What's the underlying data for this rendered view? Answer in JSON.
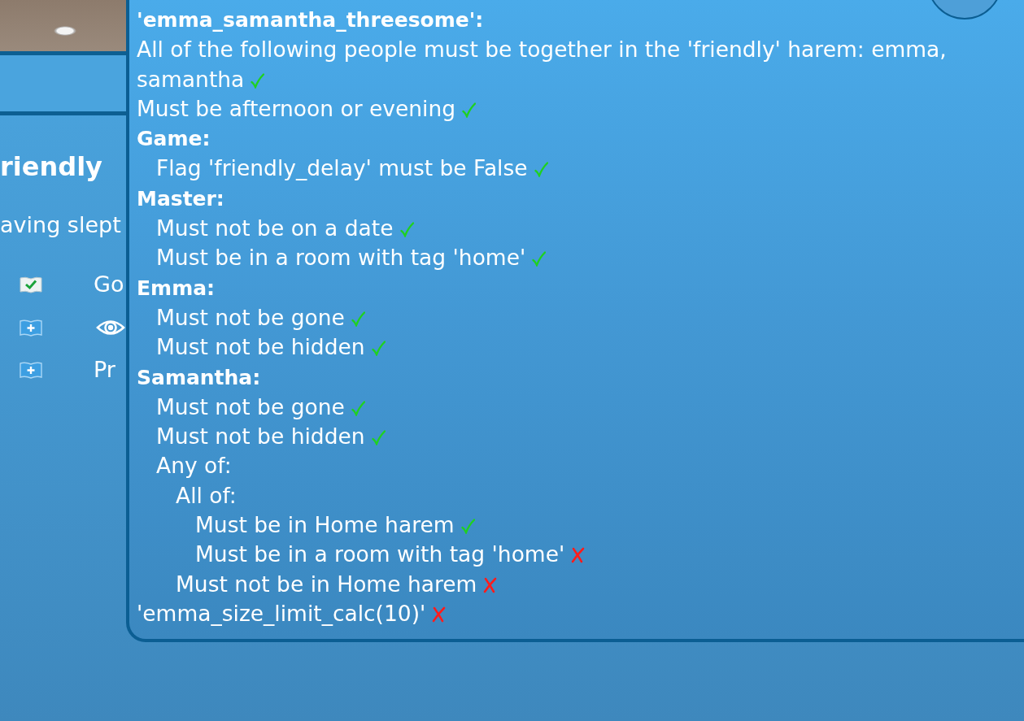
{
  "background": {
    "title": "riendly",
    "subtitle": "aving slept",
    "entries": [
      {
        "kind": "label",
        "completed": true,
        "label": "Go"
      },
      {
        "kind": "eye",
        "completed": false
      },
      {
        "kind": "label",
        "completed": false,
        "label": "Pr"
      }
    ]
  },
  "tooltip": {
    "title": "'emma_samantha_threesome':",
    "lines": [
      {
        "kind": "condition",
        "text": "All of the following people must be together in the 'friendly' harem: emma, samantha",
        "passed": true
      },
      {
        "kind": "condition",
        "text": "Must be afternoon or evening",
        "passed": true
      },
      {
        "kind": "heading",
        "text": "Game:",
        "children": [
          {
            "kind": "condition",
            "text": "Flag 'friendly_delay' must be False",
            "passed": true
          }
        ]
      },
      {
        "kind": "heading",
        "text": "Master:",
        "children": [
          {
            "kind": "condition",
            "text": "Must not be on a date",
            "passed": true
          },
          {
            "kind": "condition",
            "text": "Must be in a room with tag 'home'",
            "passed": true
          }
        ]
      },
      {
        "kind": "heading",
        "text": "Emma:",
        "children": [
          {
            "kind": "condition",
            "text": "Must not be gone",
            "passed": true
          },
          {
            "kind": "condition",
            "text": "Must not be hidden",
            "passed": true
          }
        ]
      },
      {
        "kind": "heading",
        "text": "Samantha:",
        "children": [
          {
            "kind": "condition",
            "text": "Must not be gone",
            "passed": true
          },
          {
            "kind": "condition",
            "text": "Must not be hidden",
            "passed": true
          },
          {
            "kind": "group",
            "text": "Any of:",
            "children": [
              {
                "kind": "group",
                "text": "All of:",
                "children": [
                  {
                    "kind": "condition",
                    "text": "Must be in Home harem",
                    "passed": true
                  },
                  {
                    "kind": "condition",
                    "text": "Must be in a room with tag 'home'",
                    "passed": false
                  }
                ]
              },
              {
                "kind": "condition",
                "text": "Must not be in Home harem",
                "passed": false
              }
            ]
          }
        ]
      },
      {
        "kind": "condition",
        "text": "'emma_size_limit_calc(10)'",
        "passed": false
      }
    ]
  }
}
